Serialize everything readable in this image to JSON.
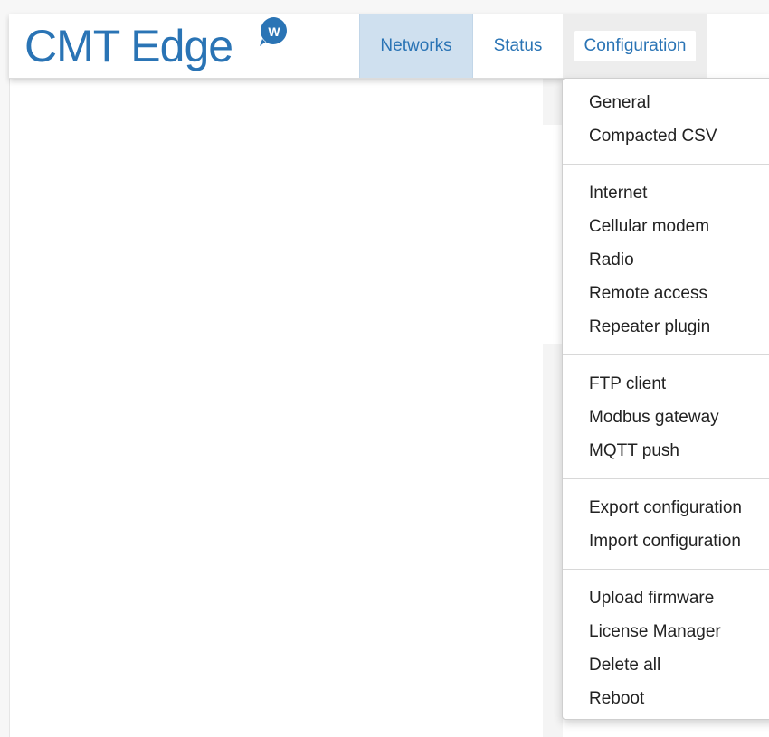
{
  "brand": {
    "name": "CMT Edge",
    "logo_letter": "W",
    "color": "#2a74b5"
  },
  "nav": {
    "items": [
      {
        "label": "Networks",
        "state": "active"
      },
      {
        "label": "Status"
      },
      {
        "label": "Configuration",
        "state": "open"
      }
    ]
  },
  "dropdown": {
    "groups": [
      [
        "General",
        "Compacted CSV"
      ],
      [
        "Internet",
        "Cellular modem",
        "Radio",
        "Remote access",
        "Repeater plugin"
      ],
      [
        "FTP client",
        "Modbus gateway",
        "MQTT push"
      ],
      [
        "Export configuration",
        "Import configuration"
      ],
      [
        "Upload firmware",
        "License Manager",
        "Delete all",
        "Reboot"
      ]
    ]
  },
  "colors": {
    "accent": "#2a74b5",
    "active_tab_bg": "#cfe0ef",
    "open_tab_bg": "#ededed"
  }
}
